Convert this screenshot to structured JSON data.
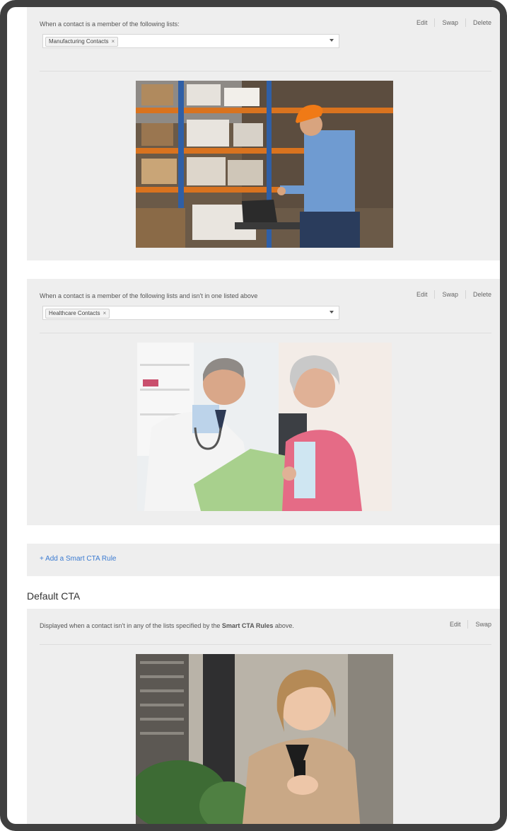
{
  "rules": [
    {
      "description": "When a contact is a member of the following lists:",
      "actions": [
        "Edit",
        "Swap",
        "Delete"
      ],
      "selected_list": "Manufacturing Contacts",
      "image_alt": "Worker in hard hat using laptop in warehouse"
    },
    {
      "description": "When a contact is a member of the following lists and isn't in one listed above",
      "actions": [
        "Edit",
        "Swap",
        "Delete"
      ],
      "selected_list": "Healthcare Contacts",
      "image_alt": "Doctor reviewing chart with senior patient"
    }
  ],
  "add_rule": {
    "label": "+ Add a Smart CTA Rule"
  },
  "default_cta": {
    "title": "Default CTA",
    "description_pre": "Displayed when a contact isn't in any of the lists specified by the ",
    "description_strong": "Smart CTA Rules",
    "description_post": " above.",
    "actions": [
      "Edit",
      "Swap"
    ],
    "image_alt": "Smiling businesswoman holding phone"
  },
  "colors": {
    "card_bg": "#eeeeee",
    "frame": "#3f3f3f",
    "link": "#3b7bd1"
  },
  "icons": {
    "tag_remove": "×",
    "dropdown": "chevron-down-icon"
  }
}
